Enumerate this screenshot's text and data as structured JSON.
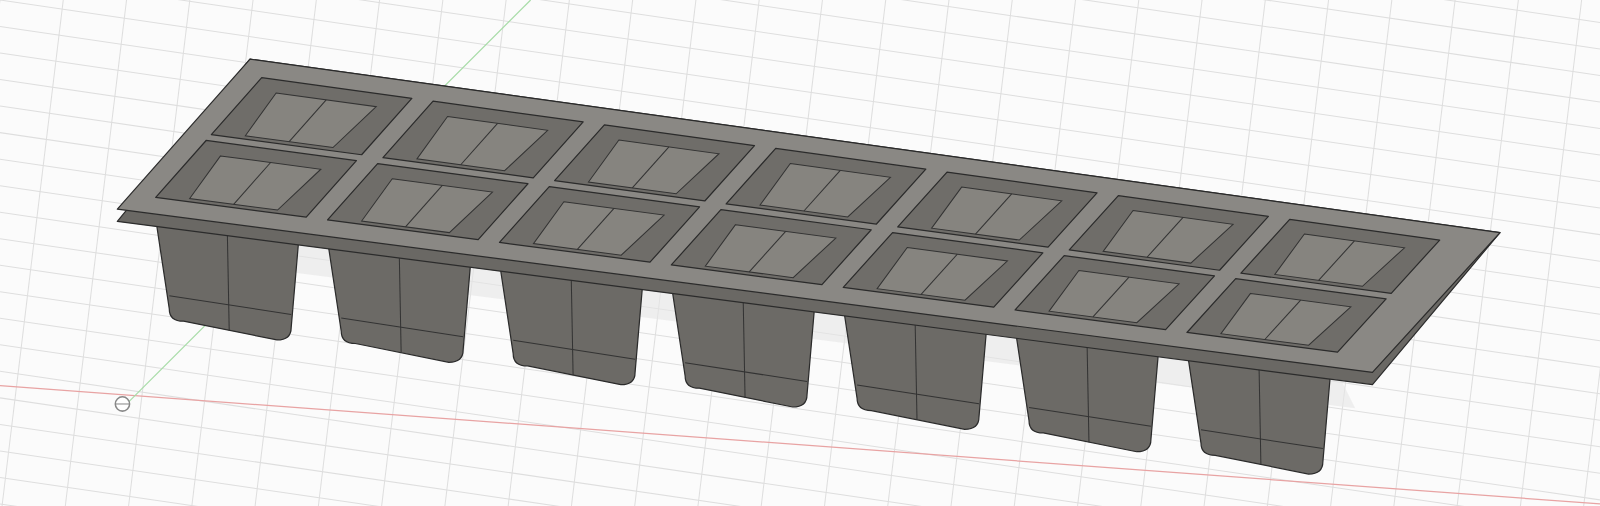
{
  "viewport": {
    "grid": true,
    "axes": true,
    "origin_marker": true
  }
}
